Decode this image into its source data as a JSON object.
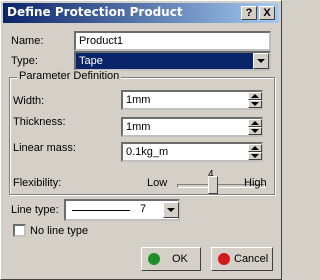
{
  "window": {
    "title": "Define Protection Product",
    "help_label": "?",
    "close_label": "X"
  },
  "name": {
    "label": "Name:",
    "value": "Product1"
  },
  "type": {
    "label": "Type:",
    "value": "Tape"
  },
  "params": {
    "group_label": "Parameter Definition",
    "width": {
      "label": "Width:",
      "value": "1mm"
    },
    "thickness": {
      "label": "Thickness:",
      "value": "1mm"
    },
    "linear_mass": {
      "label": "Linear mass:",
      "value": "0.1kg_m"
    },
    "flexibility": {
      "label": "Flexibility:",
      "low_label": "Low",
      "high_label": "High",
      "value": "4"
    }
  },
  "line_type": {
    "label": "Line type:",
    "value": "7"
  },
  "no_line_type": {
    "label": "No line type",
    "checked": false
  },
  "buttons": {
    "ok_label": "OK",
    "cancel_label": "Cancel"
  },
  "colors": {
    "ok_dot": "#1f8f2a",
    "cancel_dot": "#d11a1a",
    "title_bar": "#0a246a"
  }
}
